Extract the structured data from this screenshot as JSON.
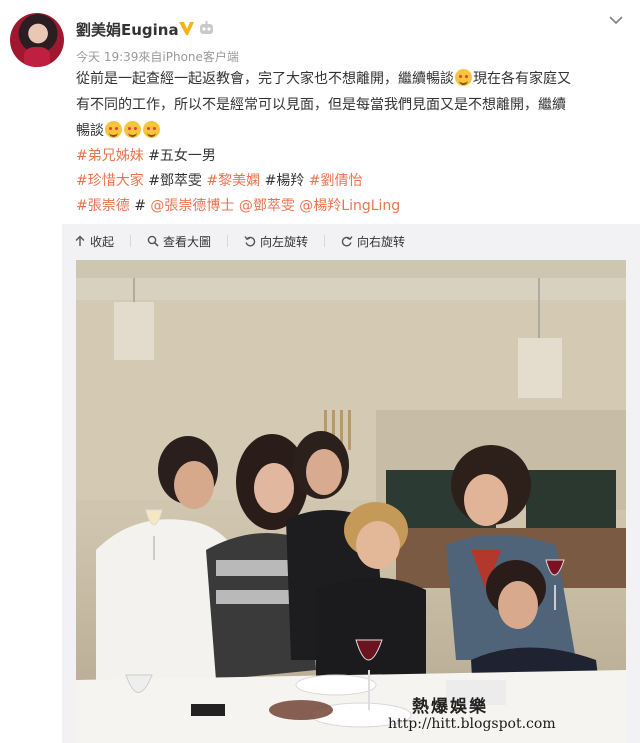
{
  "post": {
    "username": "劉美娟Eugina",
    "meta": "今天 19:39來自iPhone客户端",
    "text_line1": "從前是一起查經一起返教會，完了大家也不想離開，繼續暢談",
    "text_line1b": "現在各有家庭又",
    "text_line2": "有不同的工作，所以不是經常可以見面，但是每當我們見面又是不想離開，繼續",
    "text_line3": "暢談",
    "tags_row1": {
      "t1": "#弟兄姊妹",
      "t2": "#五女一男"
    },
    "tags_row2": {
      "t1": "#珍惜大家",
      "t2": "#鄧萃雯",
      "t3": "#黎美嫻",
      "t4": "#楊羚",
      "t5": "#劉倩怡"
    },
    "tags_row3": {
      "t1": "#張崇德",
      "t2": "#",
      "t3": "@張崇德博士",
      "t4": "@鄧萃雯",
      "t5": "@楊羚LingLing"
    }
  },
  "toolbar": {
    "collapse": "收起",
    "view_large": "查看大圖",
    "rotate_left": "向左旋转",
    "rotate_right": "向右旋转"
  },
  "watermark": {
    "title": "熱爆娛樂",
    "url": "http://hitt.blogspot.com"
  },
  "colors": {
    "link": "#eb7350",
    "verified": "#f6b215",
    "text": "#333333",
    "meta": "#999999",
    "media_bg": "#f2f2f5"
  },
  "icons": [
    "chevron-down-icon",
    "verified-badge-icon",
    "robot-icon",
    "smile-emoji-icon",
    "heart-eyes-emoji-icon",
    "collapse-arrow-icon",
    "magnifier-icon",
    "rotate-left-icon",
    "rotate-right-icon"
  ]
}
